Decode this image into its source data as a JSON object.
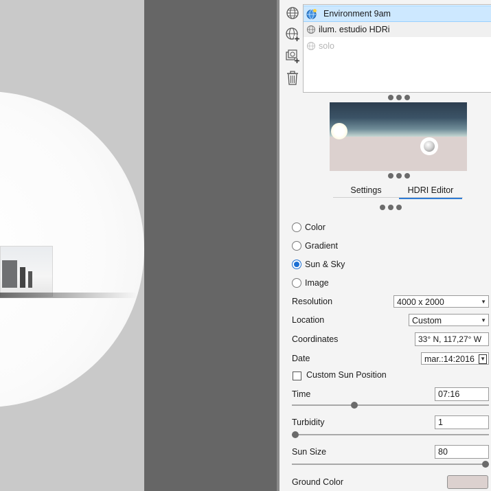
{
  "environments": {
    "items": [
      {
        "label": "Environment 9am",
        "state": "selected"
      },
      {
        "label": "ilum. estudio HDRi",
        "state": "hover"
      },
      {
        "label": "solo",
        "state": "dimmed"
      }
    ]
  },
  "toolbar": {
    "icons": [
      "environment-globe-icon",
      "add-environment-icon",
      "duplicate-environment-icon",
      "delete-icon"
    ]
  },
  "tabs": [
    {
      "label": "Settings",
      "active": false
    },
    {
      "label": "HDRI Editor",
      "active": true
    }
  ],
  "hdri": {
    "modes": [
      {
        "label": "Color",
        "selected": false
      },
      {
        "label": "Gradient",
        "selected": false
      },
      {
        "label": "Sun & Sky",
        "selected": true
      },
      {
        "label": "Image",
        "selected": false
      }
    ],
    "resolution": {
      "label": "Resolution",
      "value": "4000 x 2000"
    },
    "location": {
      "label": "Location",
      "value": "Custom"
    },
    "coordinates": {
      "label": "Coordinates",
      "value": "33° N, 117,27° W"
    },
    "date": {
      "label": "Date",
      "value": "mar.:14:2016"
    },
    "custom_sun": {
      "label": "Custom Sun Position",
      "checked": false
    },
    "time": {
      "label": "Time",
      "value": "07:16",
      "slider_fraction": 0.31
    },
    "turbidity": {
      "label": "Turbidity",
      "value": "1",
      "slider_fraction": 0.0
    },
    "sun_size": {
      "label": "Sun Size",
      "value": "80",
      "slider_fraction": 1.0
    },
    "ground_color": {
      "label": "Ground Color",
      "color": "#dcd1cf"
    }
  },
  "colors": {
    "accent": "#1c6fd3",
    "selection": "#cde8ff",
    "viewport_gap": "#666666"
  }
}
